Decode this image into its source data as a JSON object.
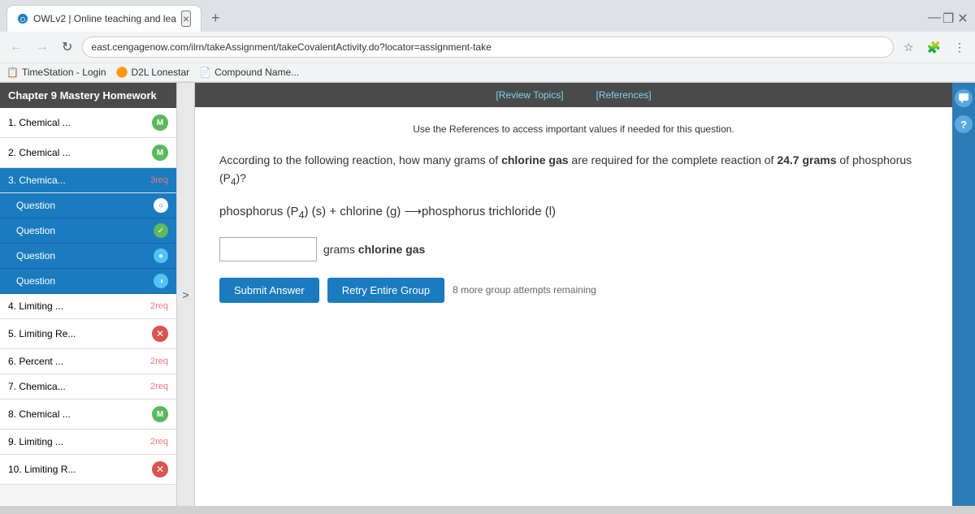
{
  "browser": {
    "tab_title": "OWLv2 | Online teaching and lea",
    "tab_close": "×",
    "new_tab": "+",
    "url": "east.cengagenow.com/ilrn/takeAssignment/takeCovalentActivity.do?locator=assignment-take",
    "nav_back": "←",
    "nav_forward": "→",
    "nav_refresh": "↻",
    "window_minimize": "—",
    "window_maximize": "❐",
    "window_close": "✕",
    "bookmarks": [
      {
        "label": "TimeStation - Login"
      },
      {
        "label": "D2L Lonestar",
        "icon": "🟠"
      },
      {
        "label": "Compound Name...",
        "icon": "📄"
      }
    ]
  },
  "sidebar": {
    "title": "Chapter 9 Mastery Homework",
    "review_topics": "[Review Topics]",
    "references": "[References]",
    "items": [
      {
        "num": "1.",
        "label": "Chemical ...",
        "badge_type": "m",
        "badge_text": "M"
      },
      {
        "num": "2.",
        "label": "Chemical ...",
        "badge_type": "m",
        "badge_text": "M"
      },
      {
        "num": "3.",
        "label": "Chemica...",
        "badge_type": "req",
        "badge_text": "3req"
      },
      {
        "num": "",
        "label": "Question",
        "badge_type": "open",
        "sub": true
      },
      {
        "num": "",
        "label": "Question",
        "badge_type": "check",
        "sub": true
      },
      {
        "num": "",
        "label": "Question",
        "badge_type": "blue",
        "sub": true
      },
      {
        "num": "",
        "label": "Question",
        "badge_type": "half",
        "sub": true
      },
      {
        "num": "4.",
        "label": "Limiting ...",
        "badge_type": "req",
        "badge_text": "2req"
      },
      {
        "num": "5.",
        "label": "Limiting Re...",
        "badge_type": "x",
        "badge_text": "✕"
      },
      {
        "num": "6.",
        "label": "Percent ...",
        "badge_type": "req",
        "badge_text": "2req"
      },
      {
        "num": "7.",
        "label": "Chemica...",
        "badge_type": "req",
        "badge_text": "2req"
      },
      {
        "num": "8.",
        "label": "Chemical ...",
        "badge_type": "m",
        "badge_text": "M"
      },
      {
        "num": "9.",
        "label": "Limiting ...",
        "badge_type": "req",
        "badge_text": "2req"
      },
      {
        "num": "10.",
        "label": "Limiting R...",
        "badge_type": "x",
        "badge_text": "✕"
      }
    ]
  },
  "content": {
    "reference_note": "Use the References to access important values if needed for this question.",
    "question_intro": "According to the following reaction, how many grams of",
    "question_bold1": "chlorine gas",
    "question_mid": "are required for the complete reaction of",
    "question_bold2": "24.7 grams",
    "question_end": "of phosphorus (P",
    "question_sub": "4",
    "question_end2": ")?",
    "reaction_line": "phosphorus (P",
    "reaction_sub": "4",
    "reaction_mid": ") (s) + chlorine (g) ⟶ phosphorus trichloride (l)",
    "answer_placeholder": "",
    "answer_unit": "grams",
    "answer_label": "chlorine gas",
    "submit_btn": "Submit Answer",
    "retry_btn": "Retry Entire Group",
    "attempts_text": "8 more group attempts remaining"
  }
}
